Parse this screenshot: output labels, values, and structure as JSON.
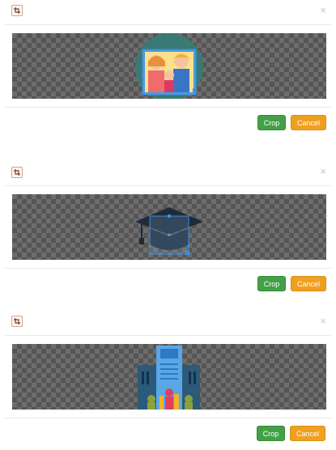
{
  "dialogs": [
    {
      "crop_label": "Crop",
      "cancel_label": "Cancel",
      "close_glyph": "×",
      "header_icon": "crop-icon",
      "image": "family-portrait"
    },
    {
      "crop_label": "Crop",
      "cancel_label": "Cancel",
      "close_glyph": "×",
      "header_icon": "crop-icon",
      "image": "graduation-cap"
    },
    {
      "crop_label": "Crop",
      "cancel_label": "Cancel",
      "close_glyph": "×",
      "header_icon": "crop-icon",
      "image": "school-building"
    }
  ],
  "colors": {
    "crop_button": "#43a047",
    "cancel_button": "#f0a020",
    "selection": "#3d8ee0"
  }
}
